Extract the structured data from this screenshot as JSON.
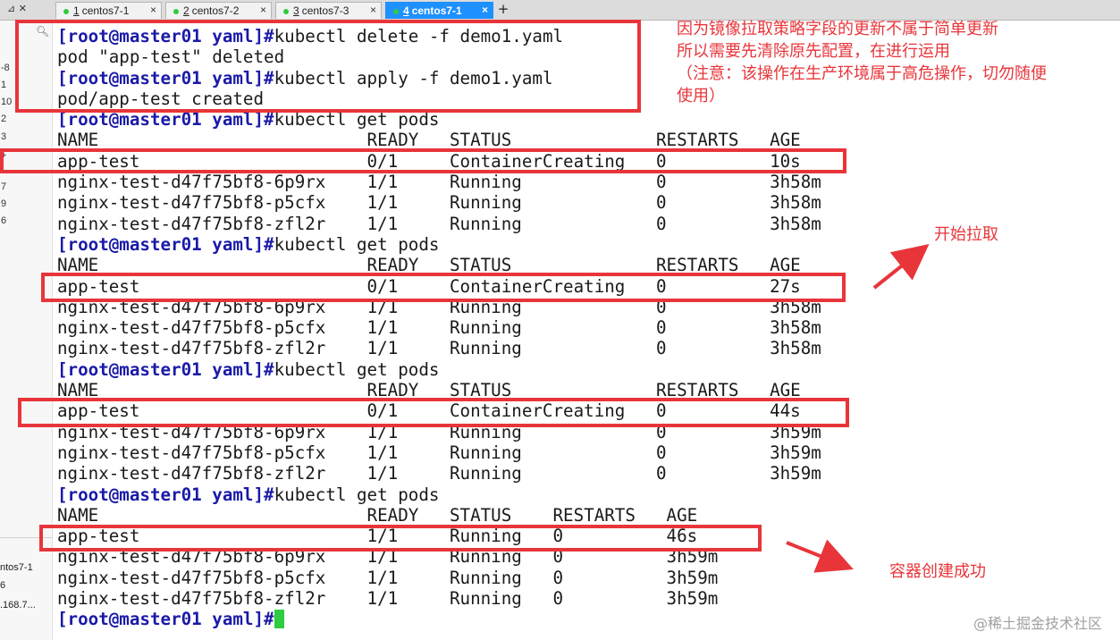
{
  "tabs": [
    {
      "num": "1",
      "label": "centos7-1",
      "active": false
    },
    {
      "num": "2",
      "label": "centos7-2",
      "active": false
    },
    {
      "num": "3",
      "label": "centos7-3",
      "active": false
    },
    {
      "num": "4",
      "label": "centos7-1",
      "active": true
    }
  ],
  "pin_icon": "pin-icon",
  "close_icon": "×",
  "newtab_icon": "+",
  "sidebar": {
    "numbers": [
      "-8",
      "1",
      "10",
      "2",
      "3",
      "+",
      "7",
      "9",
      "6"
    ],
    "session_name": "ntos7-1",
    "session_extra": "6",
    "session_ip": ".168.7..."
  },
  "terminal": {
    "lines": [
      {
        "prompt": "[root@master01 yaml]#",
        "text": "kubectl delete -f demo1.yaml"
      },
      {
        "prompt": "",
        "text": "pod \"app-test\" deleted"
      },
      {
        "prompt": "[root@master01 yaml]#",
        "text": "kubectl apply -f demo1.yaml"
      },
      {
        "prompt": "",
        "text": "pod/app-test created"
      },
      {
        "prompt": "[root@master01 yaml]#",
        "text": "kubectl get pods"
      },
      {
        "prompt": "",
        "text": "NAME                          READY   STATUS              RESTARTS   AGE"
      },
      {
        "prompt": "",
        "text": "app-test                      0/1     ContainerCreating   0          10s"
      },
      {
        "prompt": "",
        "text": "nginx-test-d47f75bf8-6p9rx    1/1     Running             0          3h58m"
      },
      {
        "prompt": "",
        "text": "nginx-test-d47f75bf8-p5cfx    1/1     Running             0          3h58m"
      },
      {
        "prompt": "",
        "text": "nginx-test-d47f75bf8-zfl2r    1/1     Running             0          3h58m"
      },
      {
        "prompt": "[root@master01 yaml]#",
        "text": "kubectl get pods"
      },
      {
        "prompt": "",
        "text": "NAME                          READY   STATUS              RESTARTS   AGE"
      },
      {
        "prompt": "",
        "text": "app-test                      0/1     ContainerCreating   0          27s"
      },
      {
        "prompt": "",
        "text": "nginx-test-d47f75bf8-6p9rx    1/1     Running             0          3h58m"
      },
      {
        "prompt": "",
        "text": "nginx-test-d47f75bf8-p5cfx    1/1     Running             0          3h58m"
      },
      {
        "prompt": "",
        "text": "nginx-test-d47f75bf8-zfl2r    1/1     Running             0          3h58m"
      },
      {
        "prompt": "[root@master01 yaml]#",
        "text": "kubectl get pods"
      },
      {
        "prompt": "",
        "text": "NAME                          READY   STATUS              RESTARTS   AGE"
      },
      {
        "prompt": "",
        "text": "app-test                      0/1     ContainerCreating   0          44s"
      },
      {
        "prompt": "",
        "text": "nginx-test-d47f75bf8-6p9rx    1/1     Running             0          3h59m"
      },
      {
        "prompt": "",
        "text": "nginx-test-d47f75bf8-p5cfx    1/1     Running             0          3h59m"
      },
      {
        "prompt": "",
        "text": "nginx-test-d47f75bf8-zfl2r    1/1     Running             0          3h59m"
      },
      {
        "prompt": "[root@master01 yaml]#",
        "text": "kubectl get pods"
      },
      {
        "prompt": "",
        "text": "NAME                          READY   STATUS    RESTARTS   AGE"
      },
      {
        "prompt": "",
        "text": "app-test                      1/1     Running   0          46s"
      },
      {
        "prompt": "",
        "text": "nginx-test-d47f75bf8-6p9rx    1/1     Running   0          3h59m"
      },
      {
        "prompt": "",
        "text": "nginx-test-d47f75bf8-p5cfx    1/1     Running   0          3h59m"
      },
      {
        "prompt": "",
        "text": "nginx-test-d47f75bf8-zfl2r    1/1     Running   0          3h59m"
      },
      {
        "prompt": "[root@master01 yaml]#",
        "text": ""
      }
    ],
    "cursor_color": "#2ecc40"
  },
  "annotations": {
    "note_lines": [
      "因为镜像拉取策略字段的更新不属于简单更新",
      "所以需要先清除原先配置，在进行运用",
      "（注意：该操作在生产环境属于高危操作，切勿随便",
      "使用）"
    ],
    "start_pull": "开始拉取",
    "success": "容器创建成功",
    "color": "#e8353a"
  },
  "watermark": "@稀土掘金技术社区"
}
